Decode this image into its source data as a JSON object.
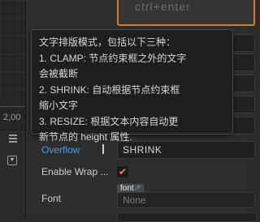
{
  "scene": {
    "tick_label": "2,00"
  },
  "preview": {
    "text": "ctrl+enter"
  },
  "tooltip": {
    "lines": [
      "文字排版模式，包括以下三种：",
      "1. CLAMP: 节点约束框之外的文字",
      "会被截断",
      "2. SHRINK: 自动根据节点约束框",
      "缩小文字",
      "3. RESIZE: 根据文本内容自动更",
      "新节点的 height 属性."
    ]
  },
  "properties": {
    "overflow": {
      "label": "Overflow",
      "value": "SHRINK"
    },
    "enable_wrap": {
      "label": "Enable Wrap ...",
      "checked": true,
      "check_glyph": "✔"
    },
    "font": {
      "label": "Font",
      "asset_tag": "font",
      "asset_tag_icon": "↗",
      "value": "None"
    }
  },
  "colors": {
    "accent_orange": "#e2781f",
    "link_blue": "#4a9be3"
  }
}
